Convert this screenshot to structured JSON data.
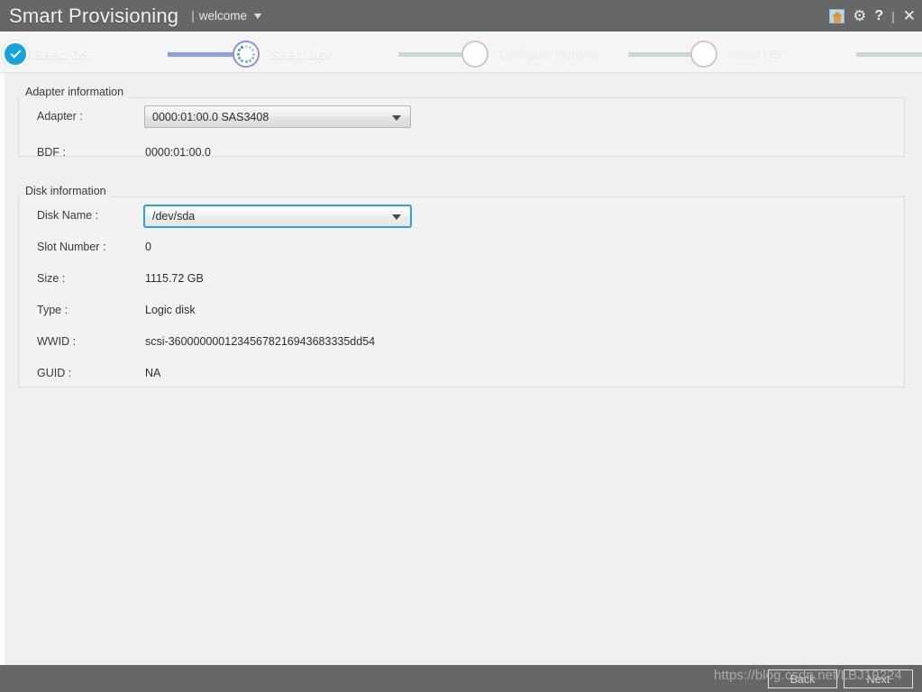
{
  "titlebar": {
    "app_title": "Smart Provisioning",
    "separator": "|",
    "welcome_label": "welcome",
    "chevron_icon": "chevron-down-icon",
    "icons": {
      "home": "home-icon",
      "settings": "gear-icon",
      "help": "question-mark-icon",
      "divider": "|",
      "close": "close-icon"
    }
  },
  "stepper": {
    "steps": [
      {
        "label": "Select OS",
        "state": "completed"
      },
      {
        "label": "Select Disk",
        "state": "active"
      },
      {
        "label": "Configure Options",
        "state": "pending"
      },
      {
        "label": "Install OS",
        "state": "pending"
      }
    ]
  },
  "adapter_group": {
    "title": "Adapter information",
    "adapter": {
      "label": "Adapter :",
      "value": "0000:01:00.0  SAS3408"
    },
    "bdf": {
      "label": "BDF :",
      "value": "0000:01:00.0"
    }
  },
  "disk_group": {
    "title": "Disk information",
    "disk_name": {
      "label": "Disk Name :",
      "value": "/dev/sda"
    },
    "rows": [
      {
        "label": "Slot Number :",
        "value": "0"
      },
      {
        "label": "Size :",
        "value": "1115.72 GB"
      },
      {
        "label": "Type :",
        "value": "Logic disk"
      },
      {
        "label": "WWID :",
        "value": "scsi-36000000012345678216943683335dd54"
      },
      {
        "label": "GUID :",
        "value": "NA"
      }
    ]
  },
  "footer": {
    "back_label": "Back",
    "next_label": "Next"
  },
  "watermark": {
    "text": "https://blog.csdn.net/LBJ19224"
  },
  "colors": {
    "titlebar_bg": "#666768",
    "step_active": "#7b8ddc",
    "step_pending": "#dfe5e3",
    "check_circle": "#17a3dd",
    "focus_border": "#2aa5d6",
    "content_bg": "#f0f0f0"
  }
}
